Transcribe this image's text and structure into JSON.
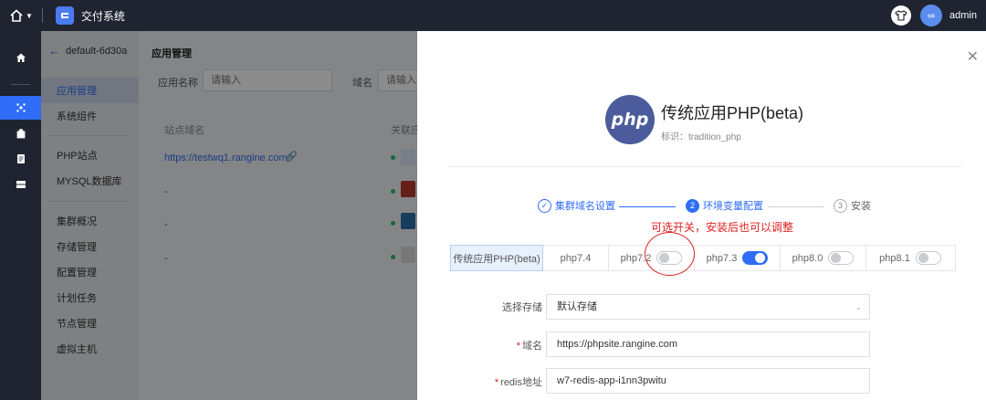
{
  "topbar": {
    "app_title": "交付系统",
    "username": "admin",
    "avatar_text": "微擎"
  },
  "menu": {
    "back_label": "default-6d30a",
    "items": [
      {
        "label": "应用管理",
        "active": true
      },
      {
        "label": "系统组件",
        "active": false
      },
      {
        "label": "PHP站点",
        "active": false
      },
      {
        "label": "MYSQL数据库",
        "active": false
      },
      {
        "label": "集群概况",
        "active": false
      },
      {
        "label": "存储管理",
        "active": false
      },
      {
        "label": "配置管理",
        "active": false
      },
      {
        "label": "计划任务",
        "active": false
      },
      {
        "label": "节点管理",
        "active": false
      },
      {
        "label": "虚拟主机",
        "active": false
      }
    ]
  },
  "main": {
    "title": "应用管理",
    "filter_app_label": "应用名称",
    "filter_app_placeholder": "请输入",
    "filter_domain_label": "域名",
    "filter_domain_placeholder": "请输入",
    "col_site_domain": "站点域名",
    "col_related": "关联应",
    "rows": [
      {
        "domain": "https://testwq1.rangine.com/",
        "is_link": true
      },
      {
        "domain": "-",
        "is_link": false
      },
      {
        "domain": "-",
        "is_link": false
      },
      {
        "domain": "-",
        "is_link": false
      }
    ]
  },
  "drawer": {
    "logo_text": "php",
    "app_name": "传统应用PHP(beta)",
    "app_id": "标识：tradition_php",
    "steps": [
      {
        "num": "✓",
        "label": "集群域名设置",
        "state": "done"
      },
      {
        "num": "2",
        "label": "环境变量配置",
        "state": "current"
      },
      {
        "num": "3",
        "label": "安装",
        "state": "wait"
      }
    ],
    "annotation": "可选开关，安装后也可以调整",
    "versions": [
      {
        "label": "传统应用PHP(beta)",
        "active": true,
        "toggle": null
      },
      {
        "label": "php7.4",
        "active": false,
        "toggle": null
      },
      {
        "label": "php7.2",
        "active": false,
        "toggle": "off"
      },
      {
        "label": "php7.3",
        "active": false,
        "toggle": "on"
      },
      {
        "label": "php8.0",
        "active": false,
        "toggle": "off"
      },
      {
        "label": "php8.1",
        "active": false,
        "toggle": "off"
      }
    ],
    "form": {
      "storage_label": "选择存储",
      "storage_value": "默认存储",
      "domain_label": "域名",
      "domain_value": "https://phpsite.rangine.com",
      "redis_label": "redis地址",
      "redis_value": "w7-redis-app-i1nn3pwitu"
    }
  },
  "colors": {
    "accent": "#2f6df6",
    "sidebar_dark": "#1f2430",
    "annotation_red": "#e02020",
    "php_logo": "#4b5b9c"
  }
}
